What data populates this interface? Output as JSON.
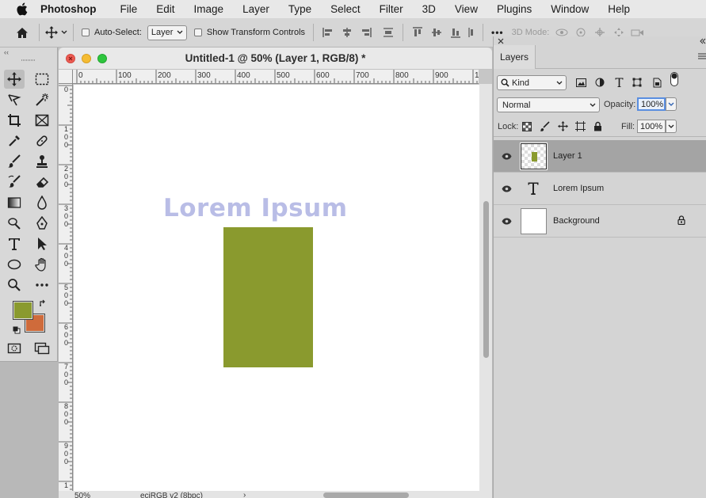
{
  "menubar": {
    "app_name": "Photoshop",
    "items": [
      "File",
      "Edit",
      "Image",
      "Layer",
      "Type",
      "Select",
      "Filter",
      "3D",
      "View",
      "Plugins",
      "Window",
      "Help"
    ]
  },
  "options_bar": {
    "auto_select_label": "Auto-Select:",
    "auto_select_value": "Layer",
    "transform_controls_label": "Show Transform Controls",
    "more_label": "•••",
    "mode_3d_label": "3D Mode:"
  },
  "document": {
    "title": "Untitled-1 @ 50% (Layer 1, RGB/8) *",
    "ruler_h_ticks": [
      "0",
      "100",
      "200",
      "300",
      "400",
      "500",
      "600",
      "700",
      "800",
      "900",
      "10"
    ],
    "ruler_v_ticks": [
      "0",
      "1\n0\n0",
      "2\n0\n0",
      "3\n0\n0",
      "4\n0\n0",
      "5\n0\n0",
      "6\n0\n0",
      "7\n0\n0",
      "8\n0\n0",
      "9\n0\n0",
      "1"
    ],
    "canvas_text": "Lorem Ipsum",
    "status_zoom": "50%",
    "status_profile": "eciRGB v2 (8bpc)",
    "status_arrow": "›"
  },
  "colors": {
    "foreground": "#8a9a2e",
    "background": "#cf6b3b",
    "text_layer_color": "#b9bde6",
    "rect_color": "#8a9a2e"
  },
  "layers_panel": {
    "tab_label": "Layers",
    "kind_label": "Kind",
    "blend_mode": "Normal",
    "opacity_label": "Opacity:",
    "opacity_value": "100%",
    "lock_label": "Lock:",
    "fill_label": "Fill:",
    "fill_value": "100%",
    "layers": [
      {
        "name": "Layer 1",
        "type": "pixel",
        "selected": true,
        "visible": true
      },
      {
        "name": "Lorem Ipsum",
        "type": "text",
        "selected": false,
        "visible": true
      },
      {
        "name": "Background",
        "type": "background",
        "selected": false,
        "visible": true,
        "locked": true
      }
    ]
  },
  "toolbar": {
    "collapse_label": "‹‹",
    "tools": [
      "move-tool",
      "marquee-tool",
      "lasso-tool",
      "magic-wand-tool",
      "crop-tool",
      "frame-tool",
      "eyedropper-tool",
      "healing-brush-tool",
      "brush-tool",
      "clone-stamp-tool",
      "history-brush-tool",
      "eraser-tool",
      "gradient-tool",
      "blur-tool",
      "dodge-tool",
      "pen-tool",
      "type-tool",
      "path-selection-tool",
      "ellipse-tool",
      "hand-tool",
      "zoom-tool",
      "more-tools",
      "quick-mask",
      "screen-mode"
    ]
  }
}
